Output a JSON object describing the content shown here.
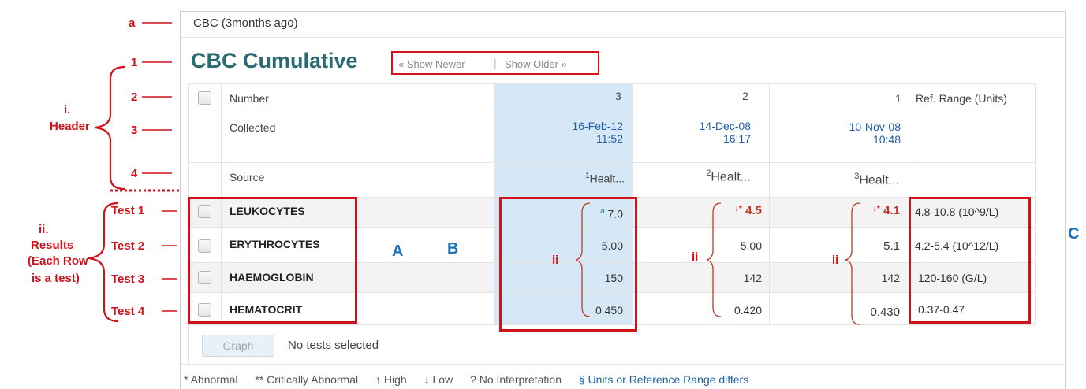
{
  "annotations": {
    "a": "a",
    "n1": "1",
    "n2": "2",
    "n3": "3",
    "n4": "4",
    "header_roman": "i.",
    "header_word": "Header",
    "results_roman": "ii.",
    "results_lines": [
      "Results",
      "(Each Row",
      "is a test)"
    ],
    "tests": [
      "Test 1",
      "Test 2",
      "Test 3",
      "Test 4"
    ],
    "A": "A",
    "B": "B",
    "C": "C",
    "ii": "ii"
  },
  "topbar": {
    "title": "CBC",
    "ago": "(3months ago)"
  },
  "title": "CBC Cumulative",
  "nav": {
    "newer": "« Show Newer",
    "sep": "|",
    "older": "Show Older »"
  },
  "header": {
    "number_label": "Number",
    "collected_label": "Collected",
    "source_label": "Source",
    "ref_label": "Ref. Range (Units)",
    "columns": [
      {
        "number": "3",
        "date": "16-Feb-12",
        "time": "11:52",
        "src_sup": "1",
        "source": "Healt..."
      },
      {
        "number": "2",
        "date": "14-Dec-08",
        "time": "16:17",
        "src_sup": "2",
        "source": "Healt..."
      },
      {
        "number": "1",
        "date": "10-Nov-08",
        "time": "10:48",
        "src_sup": "3",
        "source": "Healt..."
      }
    ]
  },
  "rows": [
    {
      "name": "LEUKOCYTES",
      "v3_sup": "a",
      "v3": "7.0",
      "v2_flag": "↓*",
      "v2": "4.5",
      "v1_flag": "↓*",
      "v1": "4.1",
      "ref": "4.8-10.8 (10^9/L)"
    },
    {
      "name": "ERYTHROCYTES",
      "v3_sup": "",
      "v3": "5.00",
      "v2_flag": "",
      "v2": "5.00",
      "v1_flag": "",
      "v1": "5.1",
      "ref": "4.2-5.4 (10^12/L)"
    },
    {
      "name": "HAEMOGLOBIN",
      "v3_sup": "",
      "v3": "150",
      "v2_flag": "",
      "v2": "142",
      "v1_flag": "",
      "v1": "142",
      "ref": "120-160 (G/L)"
    },
    {
      "name": "HEMATOCRIT",
      "v3_sup": "",
      "v3": "0.450",
      "v2_flag": "",
      "v2": "0.420",
      "v1_flag": "",
      "v1": "0.430",
      "ref": "0.37-0.47"
    }
  ],
  "footer": {
    "graph": "Graph",
    "status": "No tests selected"
  },
  "legend": {
    "abnormal": "* Abnormal",
    "critical": "** Critically Abnormal",
    "high": "↑ High",
    "low": "↓ Low",
    "nointerp": "? No Interpretation",
    "units": "§ Units or Reference Range differs"
  },
  "colors": {
    "annotation_red": "#d0121b",
    "annotation_blue": "#1f6fb5",
    "title_teal": "#2a6b73",
    "selected_column": "#d6e8f6"
  }
}
